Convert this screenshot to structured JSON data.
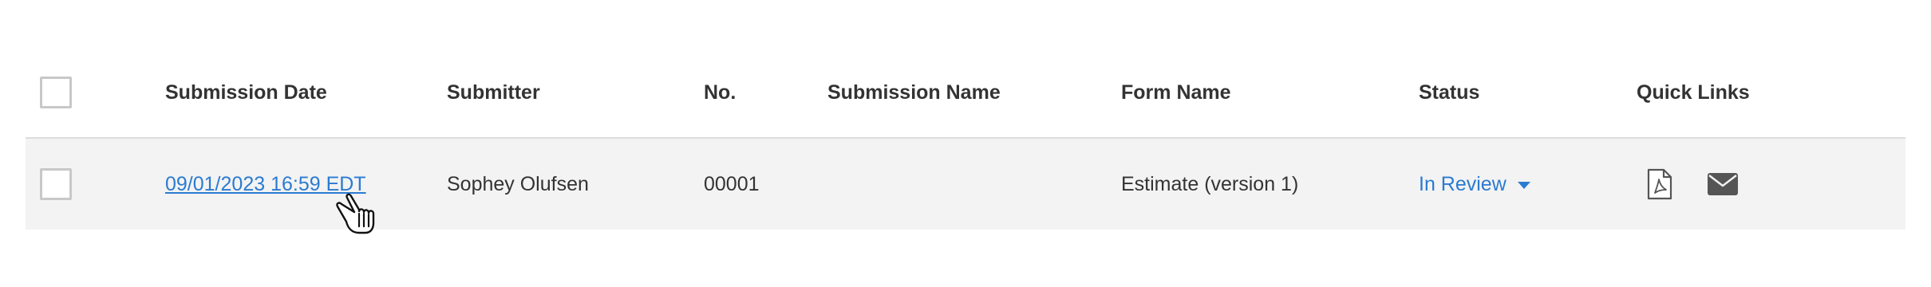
{
  "table": {
    "columns": {
      "submission_date": "Submission Date",
      "submitter": "Submitter",
      "number": "No.",
      "submission_name": "Submission Name",
      "form_name": "Form Name",
      "status": "Status",
      "quick_links": "Quick Links"
    },
    "rows": [
      {
        "submission_date": "09/01/2023 16:59 EDT",
        "submitter": "Sophey Olufsen",
        "number": "00001",
        "submission_name": "",
        "form_name": "Estimate (version 1)",
        "status": "In Review",
        "quick_links": [
          "pdf-icon",
          "mail-icon"
        ]
      }
    ]
  },
  "colors": {
    "link": "#2b7bd1",
    "row_background": "#f3f3f3",
    "checkbox_border": "#c8c8c8",
    "icon": "#555555"
  }
}
